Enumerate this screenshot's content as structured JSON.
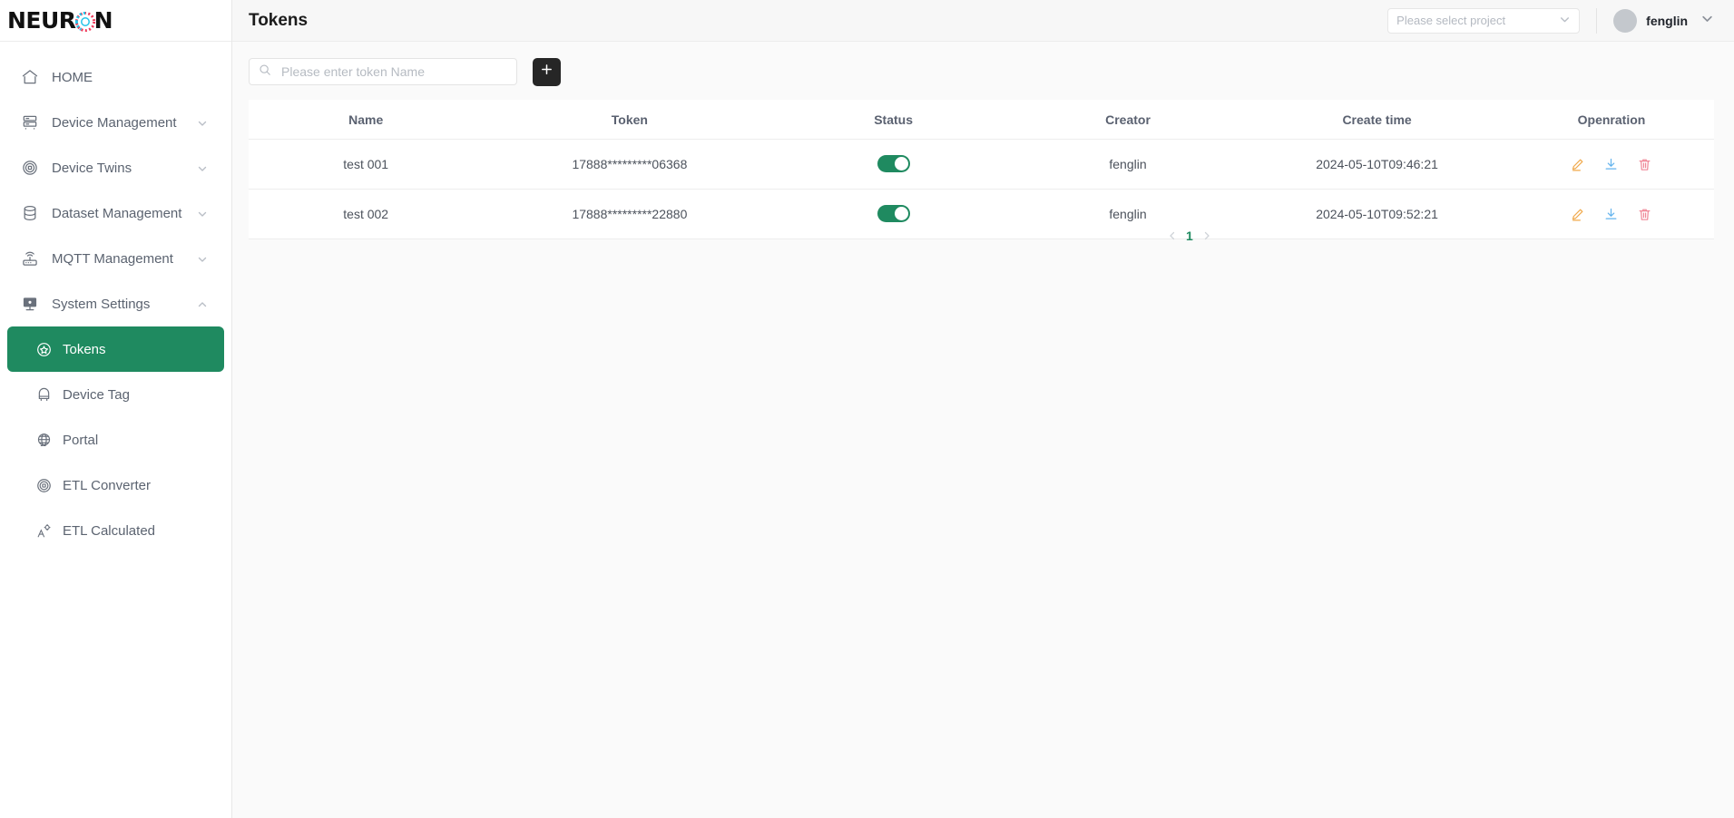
{
  "brand": {
    "name_part1": "NEUR",
    "name_part2": "N",
    "logo_icon": "neuron-burst-icon"
  },
  "sidebar": {
    "items": [
      {
        "label": "HOME",
        "icon": "home-icon",
        "expandable": false
      },
      {
        "label": "Device Management",
        "icon": "server-rack-icon",
        "expandable": true,
        "expanded": false
      },
      {
        "label": "Device Twins",
        "icon": "twins-circle-icon",
        "expandable": true,
        "expanded": false
      },
      {
        "label": "Dataset Management",
        "icon": "database-icon",
        "expandable": true,
        "expanded": false
      },
      {
        "label": "MQTT Management",
        "icon": "router-signal-icon",
        "expandable": true,
        "expanded": false
      },
      {
        "label": "System Settings",
        "icon": "monitor-gear-icon",
        "expandable": true,
        "expanded": true
      }
    ],
    "sub_items": [
      {
        "label": "Tokens",
        "icon": "badge-star-icon",
        "active": true
      },
      {
        "label": "Device Tag",
        "icon": "tag-lock-icon",
        "active": false
      },
      {
        "label": "Portal",
        "icon": "globe-icon",
        "active": false
      },
      {
        "label": "ETL Converter",
        "icon": "converter-circle-icon",
        "active": false
      },
      {
        "label": "ETL Calculated",
        "icon": "calculator-gear-icon",
        "active": false
      }
    ],
    "active_color": "#1f8a60"
  },
  "header": {
    "title": "Tokens",
    "project_select": {
      "placeholder": "Please select project",
      "value": "",
      "chevron_icon": "chevron-down-icon"
    },
    "user": {
      "name": "fenglin",
      "avatar_icon": "avatar-icon",
      "chevron_icon": "chevron-down-icon"
    }
  },
  "toolbar": {
    "search": {
      "placeholder": "Please enter token Name",
      "value": "",
      "icon": "search-icon"
    },
    "add_button": {
      "label": "+",
      "icon": "plus-icon"
    }
  },
  "table": {
    "columns": [
      "Name",
      "Token",
      "Status",
      "Creator",
      "Create time",
      "Openration"
    ],
    "rows": [
      {
        "name": "test 001",
        "token": "17888*********06368",
        "status": "on",
        "creator": "fenglin",
        "create_time": "2024-05-10T09:46:21",
        "operations": [
          "edit-icon",
          "download-icon",
          "delete-icon"
        ]
      },
      {
        "name": "test 002",
        "token": "17888*********22880",
        "status": "on",
        "creator": "fenglin",
        "create_time": "2024-05-10T09:52:21",
        "operations": [
          "edit-icon",
          "download-icon",
          "delete-icon"
        ]
      }
    ]
  },
  "pagination": {
    "prev_icon": "chevron-left-icon",
    "next_icon": "chevron-right-icon",
    "current_page": "1"
  },
  "colors": {
    "accent_green": "#1f8a60",
    "edit_orange": "#f0a84a",
    "download_blue": "#63b3ed",
    "delete_pink": "#f08898",
    "add_button_dark": "#262626"
  }
}
